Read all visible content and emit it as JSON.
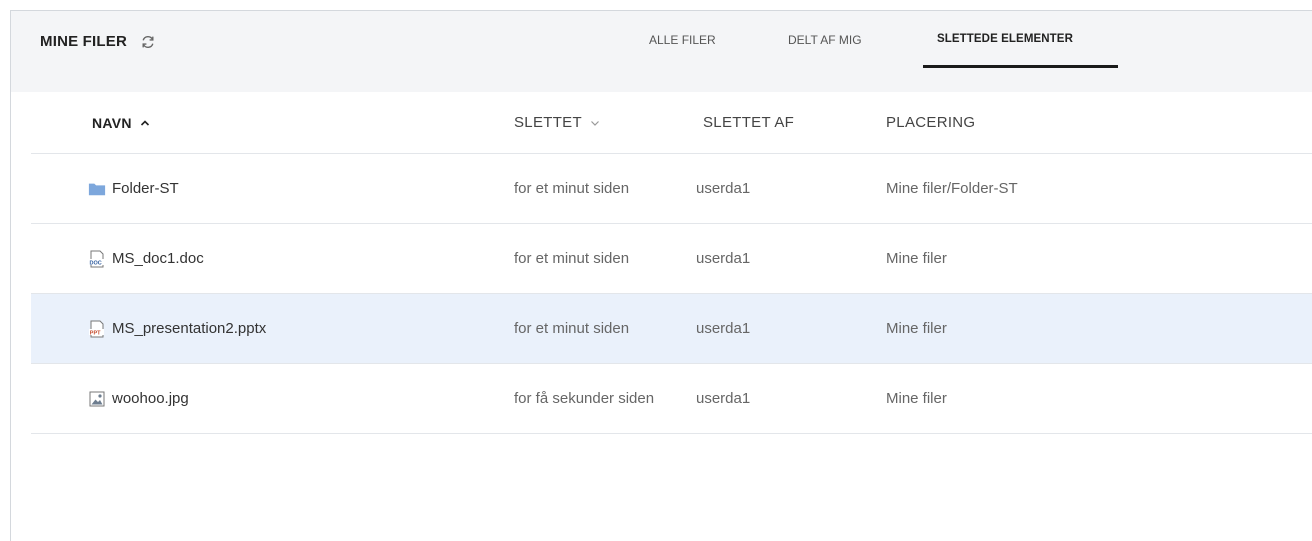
{
  "header": {
    "title": "MINE FILER",
    "tabs": [
      {
        "label": "ALLE FILER",
        "active": false
      },
      {
        "label": "DELT AF MIG",
        "active": false
      },
      {
        "label": "SLETTEDE ELEMENTER",
        "active": true
      }
    ]
  },
  "table": {
    "columns": {
      "name": "NAVN",
      "deleted": "SLETTET",
      "deleted_by": "SLETTET AF",
      "location": "PLACERING"
    },
    "sort": {
      "name_direction": "ascending",
      "deleted_indicator": "chevron-down"
    },
    "rows": [
      {
        "icon": "folder-icon",
        "name": "Folder-ST",
        "deleted": "for et minut siden",
        "deleted_by": "userda1",
        "location": "Mine filer/Folder-ST",
        "selected": false
      },
      {
        "icon": "doc-file-icon",
        "name": "MS_doc1.doc",
        "deleted": "for et minut siden",
        "deleted_by": "userda1",
        "location": "Mine filer",
        "selected": false
      },
      {
        "icon": "ppt-file-icon",
        "name": "MS_presentation2.pptx",
        "deleted": "for et minut siden",
        "deleted_by": "userda1",
        "location": "Mine filer",
        "selected": true
      },
      {
        "icon": "image-file-icon",
        "name": "woohoo.jpg",
        "deleted": "for få sekunder siden",
        "deleted_by": "userda1",
        "location": "Mine filer",
        "selected": false
      }
    ]
  },
  "colors": {
    "header_bg": "#f4f5f7",
    "selected_row_bg": "#eaf1fb",
    "folder": "#7da7dc",
    "active_tab_underline": "#1a1a1a"
  }
}
